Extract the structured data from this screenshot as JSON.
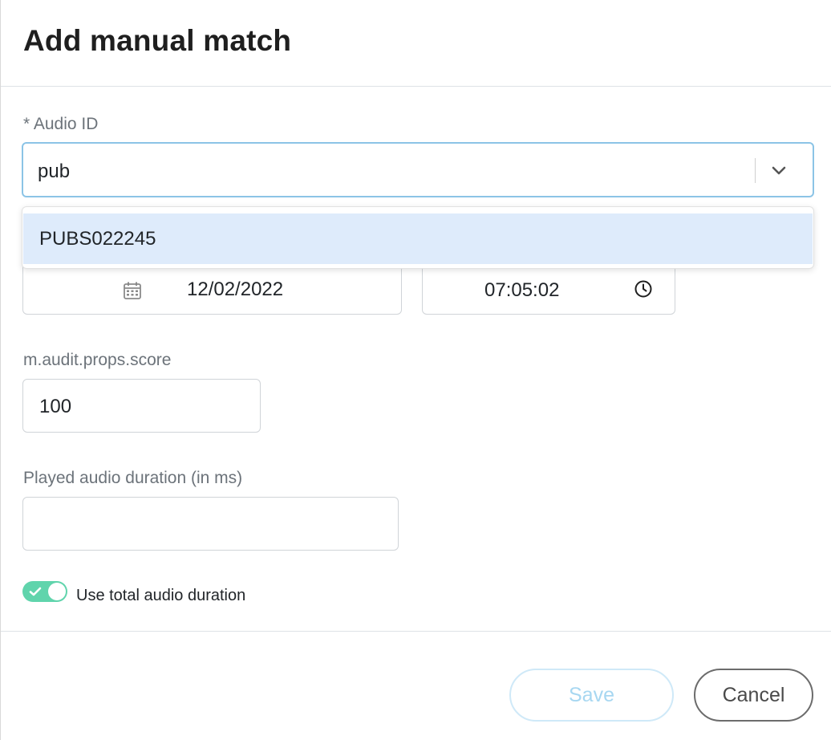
{
  "modal": {
    "title": "Add manual match"
  },
  "audio_id": {
    "label": "* Audio ID",
    "input_value": "pub",
    "dropdown_options": [
      "PUBS022245"
    ]
  },
  "date_field": {
    "value": "12/02/2022",
    "icon": "calendar-icon"
  },
  "time_field": {
    "value": "07:05:02",
    "icon": "clock-icon"
  },
  "score": {
    "label": "m.audit.props.score",
    "value": "100"
  },
  "duration": {
    "label": "Played audio duration (in ms)",
    "value": ""
  },
  "toggle": {
    "label": "Use total audio duration",
    "checked": true,
    "color": "#60d4ac"
  },
  "footer": {
    "save_label": "Save",
    "cancel_label": "Cancel"
  }
}
